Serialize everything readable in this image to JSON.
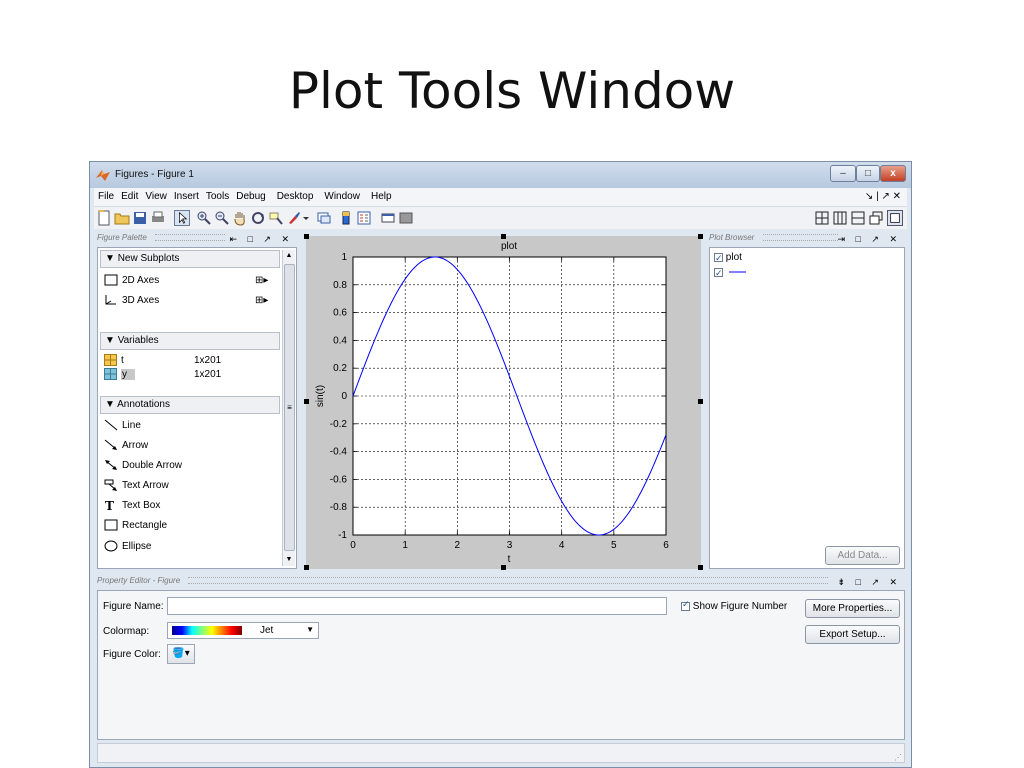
{
  "slide": {
    "title": "Plot Tools Window"
  },
  "window": {
    "title": "Figures - Figure 1",
    "menu": [
      "File",
      "Edit",
      "View",
      "Insert",
      "Tools",
      "Debug",
      "Desktop",
      "Window",
      "Help"
    ]
  },
  "figure_palette": {
    "title": "Figure Palette",
    "sections": {
      "new_subplots": "New Subplots",
      "variables": "Variables",
      "annotations": "Annotations"
    },
    "subplots": [
      "2D Axes",
      "3D Axes"
    ],
    "variables": [
      {
        "name": "t",
        "size": "1x201"
      },
      {
        "name": "y",
        "size": "1x201"
      }
    ],
    "annotations": [
      "Line",
      "Arrow",
      "Double Arrow",
      "Text Arrow",
      "Text Box",
      "Rectangle",
      "Ellipse"
    ]
  },
  "plot_browser": {
    "title": "Plot Browser",
    "entries": [
      "plot"
    ],
    "add_data": "Add Data..."
  },
  "property_editor": {
    "title": "Property Editor - Figure",
    "figure_name_label": "Figure Name:",
    "figure_name_value": "",
    "show_figure_number": "Show Figure Number",
    "colormap_label": "Colormap:",
    "colormap_value": "Jet",
    "figure_color_label": "Figure Color:",
    "more_properties": "More Properties...",
    "export_setup": "Export Setup..."
  },
  "chart_data": {
    "type": "line",
    "title": "plot",
    "xlabel": "t",
    "ylabel": "sin(t)",
    "xlim": [
      0,
      6
    ],
    "ylim": [
      -1,
      1
    ],
    "xticks": [
      0,
      1,
      2,
      3,
      4,
      5,
      6
    ],
    "yticks": [
      -1,
      -0.8,
      -0.6,
      -0.4,
      -0.2,
      0,
      0.2,
      0.4,
      0.6,
      0.8,
      1
    ],
    "grid": true,
    "series": [
      {
        "function": "sin(t)",
        "t_start": 0,
        "t_end": 6,
        "samples": 201,
        "color": "#0000ff"
      }
    ]
  },
  "colors": {
    "line": "#0000ff",
    "titlebar": "#b7c9df"
  }
}
